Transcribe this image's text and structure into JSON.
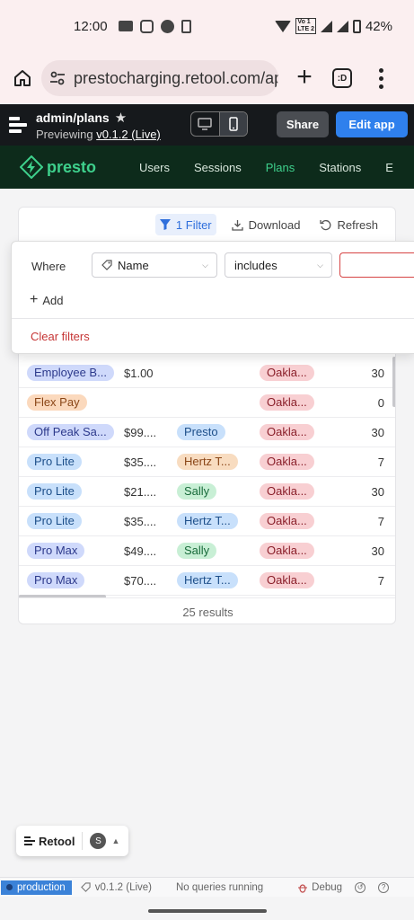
{
  "status_bar": {
    "time": "12:00",
    "battery": "42%",
    "lte_label_top": "Vo 1",
    "lte_label_bottom": "LTE 2"
  },
  "browser": {
    "url": "prestocharging.retool.com/app",
    "tabs_label": ":D"
  },
  "retool_header": {
    "title": "admin/plans",
    "previewing_label": "Previewing",
    "version": "v0.1.2 (Live)",
    "share_label": "Share",
    "edit_label": "Edit app"
  },
  "presto_nav": {
    "brand": "presto",
    "brand_color": "#3ed08c",
    "links": [
      "Users",
      "Sessions",
      "Plans",
      "Stations",
      "E"
    ],
    "active": "Plans"
  },
  "toolbar": {
    "filter_label": "1 Filter",
    "download_label": "Download",
    "refresh_label": "Refresh"
  },
  "filter_popover": {
    "where_label": "Where",
    "column_value": "Name",
    "operator_value": "includes",
    "input_value": "",
    "add_label": "Add",
    "clear_label": "Clear filters"
  },
  "table": {
    "rows": [
      {
        "name": "Employee B...",
        "name_color": "purple",
        "price": "$1.00",
        "partner": "",
        "partner_color": "",
        "location": "Oakla...",
        "days": "30"
      },
      {
        "name": "Flex Pay",
        "name_color": "orange",
        "price": "",
        "partner": "",
        "partner_color": "",
        "location": "Oakla...",
        "days": "0"
      },
      {
        "name": "Off Peak Sa...",
        "name_color": "purple",
        "price": "$99....",
        "partner": "Presto",
        "partner_color": "blue",
        "location": "Oakla...",
        "days": "30"
      },
      {
        "name": "Pro Lite",
        "name_color": "blue",
        "price": "$35....",
        "partner": "Hertz T...",
        "partner_color": "tan",
        "location": "Oakla...",
        "days": "7"
      },
      {
        "name": "Pro Lite",
        "name_color": "blue",
        "price": "$21....",
        "partner": "Sally",
        "partner_color": "green",
        "location": "Oakla...",
        "days": "30"
      },
      {
        "name": "Pro Lite",
        "name_color": "blue",
        "price": "$35....",
        "partner": "Hertz T...",
        "partner_color": "blue",
        "location": "Oakla...",
        "days": "7"
      },
      {
        "name": "Pro Max",
        "name_color": "purple",
        "price": "$49....",
        "partner": "Sally",
        "partner_color": "green",
        "location": "Oakla...",
        "days": "30"
      },
      {
        "name": "Pro Max",
        "name_color": "purple",
        "price": "$70....",
        "partner": "Hertz T...",
        "partner_color": "blue",
        "location": "Oakla...",
        "days": "7"
      }
    ],
    "results_label": "25 results"
  },
  "widget": {
    "label": "Retool",
    "avatar_initial": "S"
  },
  "bottom_bar": {
    "environment": "production",
    "version": "v0.1.2 (Live)",
    "queries_status": "No queries running",
    "debug_label": "Debug"
  }
}
